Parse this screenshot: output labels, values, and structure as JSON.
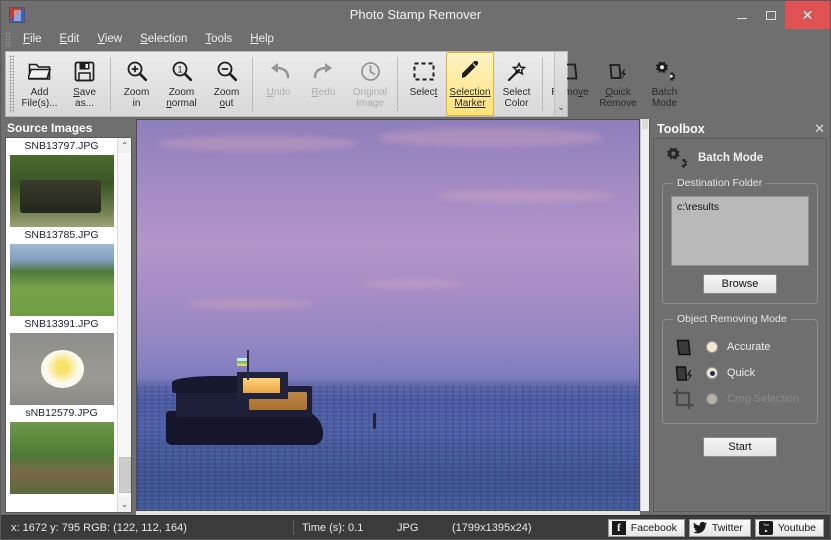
{
  "window": {
    "title": "Photo Stamp Remover",
    "app_icon": "app-logo-icon",
    "minimize": "–",
    "maximize": "❐",
    "close": "✕"
  },
  "menubar": {
    "items": [
      {
        "label": "File",
        "accel": "F"
      },
      {
        "label": "Edit",
        "accel": "E"
      },
      {
        "label": "View",
        "accel": "V"
      },
      {
        "label": "Selection",
        "accel": "S"
      },
      {
        "label": "Tools",
        "accel": "T"
      },
      {
        "label": "Help",
        "accel": "H"
      }
    ]
  },
  "toolbar": {
    "overflow_glyph": "⌄",
    "buttons": [
      {
        "name": "add-files",
        "line1": "Add",
        "line2": "File(s)...",
        "icon": "folder-open-icon",
        "state": "normal"
      },
      {
        "name": "save-as",
        "line1": "Save",
        "line2": "as...",
        "icon": "floppy-save-icon",
        "state": "normal"
      },
      {
        "name": "zoom-in",
        "line1": "Zoom",
        "line2": "in",
        "icon": "magnifier-plus-icon",
        "state": "normal"
      },
      {
        "name": "zoom-normal",
        "line1": "Zoom",
        "line2": "normal",
        "icon": "magnifier-one-icon",
        "state": "normal"
      },
      {
        "name": "zoom-out",
        "line1": "Zoom",
        "line2": "out",
        "icon": "magnifier-minus-icon",
        "state": "normal"
      },
      {
        "name": "undo",
        "line1": "Undo",
        "line2": "",
        "icon": "undo-arrow-icon",
        "state": "disabled"
      },
      {
        "name": "redo",
        "line1": "Redo",
        "line2": "",
        "icon": "redo-arrow-icon",
        "state": "disabled"
      },
      {
        "name": "original-image",
        "line1": "Original",
        "line2": "Image",
        "icon": "clock-history-icon",
        "state": "disabled"
      },
      {
        "name": "select",
        "line1": "Select",
        "line2": "",
        "icon": "marquee-select-icon",
        "state": "normal"
      },
      {
        "name": "selection-marker",
        "line1": "Selection",
        "line2": "Marker",
        "icon": "marker-pen-icon",
        "state": "active"
      },
      {
        "name": "select-color",
        "line1": "Select",
        "line2": "Color",
        "icon": "magic-wand-icon",
        "state": "normal"
      },
      {
        "name": "remove",
        "line1": "Remove",
        "line2": "",
        "icon": "eraser-icon",
        "state": "normal"
      },
      {
        "name": "quick-remove",
        "line1": "Quick",
        "line2": "Remove",
        "icon": "eraser-lightning-icon",
        "state": "normal"
      },
      {
        "name": "batch-mode",
        "line1": "Batch",
        "line2": "Mode",
        "icon": "gears-icon",
        "state": "normal"
      }
    ]
  },
  "source_images": {
    "title": "Source Images",
    "scroll_up": "⌃",
    "scroll_down": "⌄",
    "items": [
      {
        "caption": "SNB13797.JPG",
        "thumb": "jeep-in-jungle"
      },
      {
        "caption": "SNB13785.JPG",
        "thumb": "rice-field-palms"
      },
      {
        "caption": "SNB13391.JPG",
        "thumb": "ducks-on-grass"
      },
      {
        "caption": "sNB12579.JPG",
        "thumb": "frangipani-flower"
      },
      {
        "caption": "",
        "thumb": "fallen-tree-jungle"
      }
    ]
  },
  "canvas": {
    "image_description": "boat-at-twilight-on-sea"
  },
  "toolbox": {
    "title": "Toolbox",
    "close_glyph": "✕",
    "mode_icon": "gears-icon",
    "mode_title": "Batch Mode",
    "destination": {
      "legend": "Destination Folder",
      "value": "c:\\results",
      "browse_label": "Browse"
    },
    "removing_mode": {
      "legend": "Object Removing Mode",
      "options": [
        {
          "label": "Accurate",
          "icon": "eraser-icon",
          "selected": false,
          "disabled": false
        },
        {
          "label": "Quick",
          "icon": "eraser-lightning-icon",
          "selected": true,
          "disabled": false
        },
        {
          "label": "Crop Selection",
          "icon": "crop-icon",
          "selected": false,
          "disabled": true
        }
      ]
    },
    "start_label": "Start"
  },
  "statusbar": {
    "coords": "x: 1672 y: 795  RGB: (122, 112, 164)",
    "time": "Time (s): 0.1",
    "format": "JPG",
    "dimensions": "(1799x1395x24)",
    "social": [
      {
        "label": "Facebook",
        "icon": "facebook-icon",
        "glyph": "f"
      },
      {
        "label": "Twitter",
        "icon": "twitter-bird-icon",
        "glyph": ""
      },
      {
        "label": "Youtube",
        "icon": "youtube-icon",
        "glyph": ""
      }
    ]
  },
  "colors": {
    "chrome": "#6f6f6f",
    "toolbar_bg": "#e6e6e6",
    "active_tool": "#ffe27a",
    "close_button": "#e05252",
    "statusbar": "#3b3b3b"
  }
}
